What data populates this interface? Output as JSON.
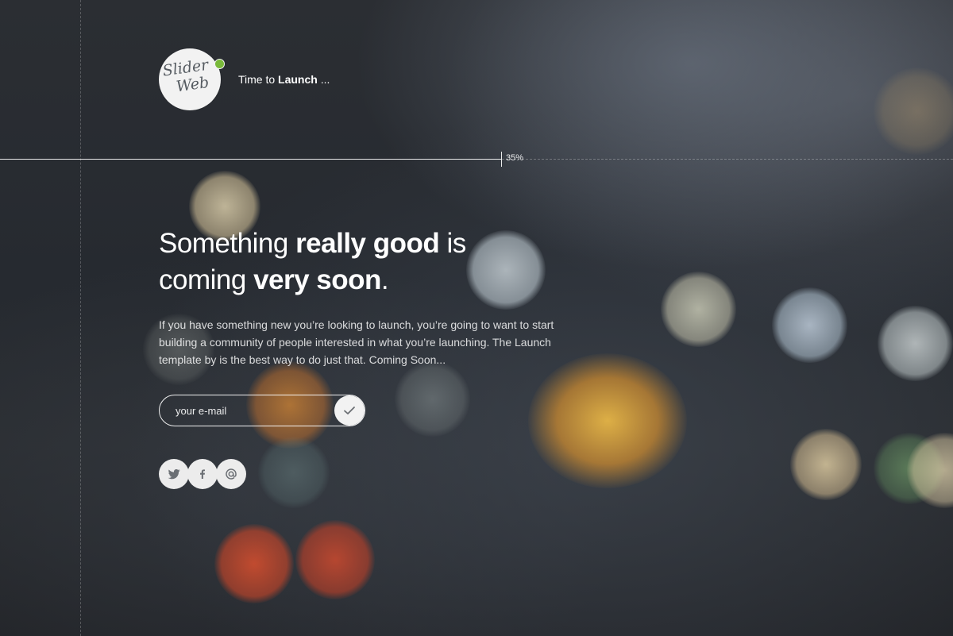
{
  "header": {
    "logo": {
      "line1": "Slider",
      "line2": "Web"
    },
    "tagline_prefix": "Time to ",
    "tagline_bold": "Launch",
    "tagline_suffix": " ..."
  },
  "progress": {
    "value_percent": 35,
    "label": "35%"
  },
  "hero": {
    "headline_part1": "Something ",
    "headline_bold1": "really good",
    "headline_part2": " is",
    "headline_part3": "coming ",
    "headline_bold2": "very soon",
    "headline_part4": ".",
    "description": "If you have something new you’re looking to launch, you’re going to want to start building a community of people interested in what you’re launching. The Launch template by is the best way to do just that. Coming Soon..."
  },
  "subscribe": {
    "placeholder": "your e-mail",
    "value": "",
    "submit_icon": "checkmark-icon"
  },
  "social": [
    {
      "icon": "twitter-icon"
    },
    {
      "icon": "facebook-icon"
    },
    {
      "icon": "at-sign-icon"
    }
  ],
  "colors": {
    "background": "#262a30",
    "text": "#ffffff",
    "button_fill": "#f2f2f2",
    "icon": "#6b6f74",
    "logo_badge": "#79b93a"
  }
}
